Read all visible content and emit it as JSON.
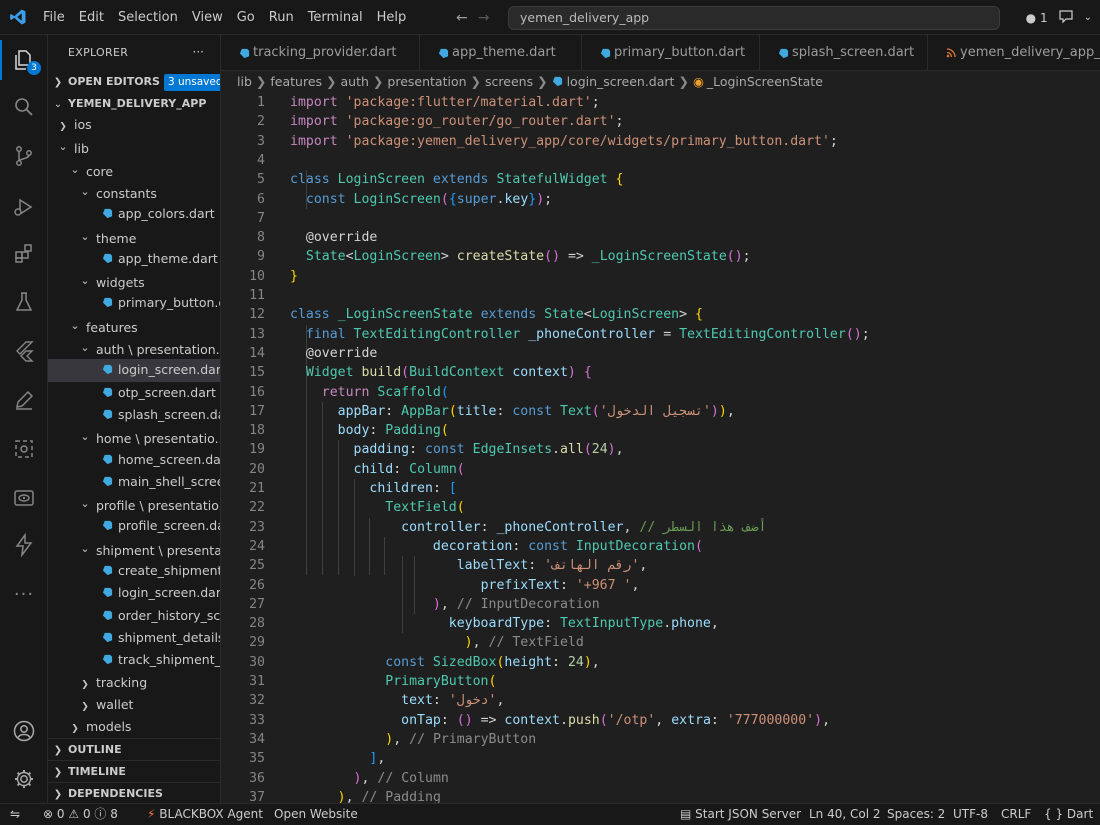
{
  "titlebar": {
    "menu": [
      "File",
      "Edit",
      "Selection",
      "View",
      "Go",
      "Run",
      "Terminal",
      "Help"
    ],
    "command_center": "yemen_delivery_app",
    "notifications_count": "1"
  },
  "activitybar": {
    "explorer_badge": "3",
    "icons": [
      "explorer-icon",
      "search-icon",
      "source-control-icon",
      "run-debug-icon",
      "extensions-icon",
      "testing-icon",
      "flutter-icon",
      "edit-icon",
      "remote-explorer-icon",
      "preview-icon",
      "bolt-icon",
      "more-icon",
      "account-icon",
      "settings-icon"
    ]
  },
  "sidebar": {
    "title": "EXPLORER",
    "more": "···",
    "open_editors": "OPEN EDITORS",
    "unsaved_badge": "3 unsaved",
    "project": "YEMEN_DELIVERY_APP",
    "tree": [
      {
        "label": "ios",
        "type": "folder",
        "expanded": false,
        "depth": 1
      },
      {
        "label": "lib",
        "type": "folder",
        "expanded": true,
        "depth": 1
      },
      {
        "label": "core",
        "type": "folder",
        "expanded": true,
        "depth": 2
      },
      {
        "label": "constants",
        "type": "folder",
        "expanded": true,
        "depth": 3
      },
      {
        "label": "app_colors.dart",
        "type": "file",
        "depth": 4
      },
      {
        "label": "theme",
        "type": "folder",
        "expanded": true,
        "depth": 3
      },
      {
        "label": "app_theme.dart",
        "type": "file",
        "depth": 4
      },
      {
        "label": "widgets",
        "type": "folder",
        "expanded": true,
        "depth": 3
      },
      {
        "label": "primary_button.dart",
        "type": "file",
        "depth": 4
      },
      {
        "label": "features",
        "type": "folder",
        "expanded": true,
        "depth": 2
      },
      {
        "label": "auth \\ presentation...",
        "type": "folder",
        "expanded": true,
        "depth": 3
      },
      {
        "label": "login_screen.dart",
        "type": "file",
        "depth": 4,
        "selected": true
      },
      {
        "label": "otp_screen.dart",
        "type": "file",
        "depth": 4
      },
      {
        "label": "splash_screen.dart",
        "type": "file",
        "depth": 4
      },
      {
        "label": "home \\ presentatio...",
        "type": "folder",
        "expanded": true,
        "depth": 3
      },
      {
        "label": "home_screen.dart",
        "type": "file",
        "depth": 4
      },
      {
        "label": "main_shell_screen....",
        "type": "file",
        "depth": 4
      },
      {
        "label": "profile \\ presentatio...",
        "type": "folder",
        "expanded": true,
        "depth": 3
      },
      {
        "label": "profile_screen.dart",
        "type": "file",
        "depth": 4
      },
      {
        "label": "shipment \\ presenta...",
        "type": "folder",
        "expanded": true,
        "depth": 3
      },
      {
        "label": "create_shipment_s...",
        "type": "file",
        "depth": 4
      },
      {
        "label": "login_screen.dart",
        "type": "file",
        "depth": 4
      },
      {
        "label": "order_history_scre...",
        "type": "file",
        "depth": 4
      },
      {
        "label": "shipment_details_...",
        "type": "file",
        "depth": 4
      },
      {
        "label": "track_shipment_sc...",
        "type": "file",
        "depth": 4
      },
      {
        "label": "tracking",
        "type": "folder",
        "expanded": false,
        "depth": 3
      },
      {
        "label": "wallet",
        "type": "folder",
        "expanded": false,
        "depth": 3
      },
      {
        "label": "models",
        "type": "folder",
        "expanded": false,
        "depth": 2
      }
    ],
    "outline": "OUTLINE",
    "timeline": "TIMELINE",
    "dependencies": "DEPENDENCIES"
  },
  "tabs": [
    {
      "label": "tracking_provider.dart",
      "icon": "dart-icon"
    },
    {
      "label": "app_theme.dart",
      "icon": "dart-icon"
    },
    {
      "label": "primary_button.dart",
      "icon": "dart-icon"
    },
    {
      "label": "splash_screen.dart",
      "icon": "dart-icon"
    },
    {
      "label": "yemen_delivery_app_and",
      "icon": "rss-icon"
    }
  ],
  "breadcrumb": [
    "lib",
    "features",
    "auth",
    "presentation",
    "screens",
    "login_screen.dart",
    "_LoginScreenState"
  ],
  "editor": {
    "lines": [
      [
        [
          "kw2",
          "import "
        ],
        [
          "str",
          "'package:flutter/material.dart'"
        ],
        [
          "pl",
          ";"
        ]
      ],
      [
        [
          "kw2",
          "import "
        ],
        [
          "str",
          "'package:go_router/go_router.dart'"
        ],
        [
          "pl",
          ";"
        ]
      ],
      [
        [
          "kw2",
          "import "
        ],
        [
          "str",
          "'package:yemen_delivery_app/core/widgets/primary_button.dart'"
        ],
        [
          "pl",
          ";"
        ]
      ],
      [],
      [
        [
          "kw",
          "class "
        ],
        [
          "cls",
          "LoginScreen "
        ],
        [
          "kw",
          "extends "
        ],
        [
          "cls",
          "StatefulWidget "
        ],
        [
          "br1",
          "{"
        ]
      ],
      [
        [
          "pl",
          "  "
        ],
        [
          "kw",
          "const "
        ],
        [
          "cls",
          "LoginScreen"
        ],
        [
          "br2",
          "("
        ],
        [
          "br3",
          "{"
        ],
        [
          "kw",
          "super"
        ],
        [
          "pl",
          "."
        ],
        [
          "var",
          "key"
        ],
        [
          "br3",
          "}"
        ],
        [
          "br2",
          ")"
        ],
        [
          "pl",
          ";"
        ]
      ],
      [],
      [
        [
          "pl",
          "  "
        ],
        [
          "ann",
          "@override"
        ]
      ],
      [
        [
          "pl",
          "  "
        ],
        [
          "cls",
          "State"
        ],
        [
          "pl",
          "<"
        ],
        [
          "cls",
          "LoginScreen"
        ],
        [
          "pl",
          "> "
        ],
        [
          "fn",
          "createState"
        ],
        [
          "br2",
          "()"
        ],
        [
          "pl",
          " => "
        ],
        [
          "cls",
          "_LoginScreenState"
        ],
        [
          "br2",
          "()"
        ],
        [
          "pl",
          ";"
        ]
      ],
      [
        [
          "br1",
          "}"
        ]
      ],
      [],
      [
        [
          "kw",
          "class "
        ],
        [
          "cls",
          "_LoginScreenState "
        ],
        [
          "kw",
          "extends "
        ],
        [
          "cls",
          "State"
        ],
        [
          "pl",
          "<"
        ],
        [
          "cls",
          "LoginScreen"
        ],
        [
          "pl",
          "> "
        ],
        [
          "br1",
          "{"
        ]
      ],
      [
        [
          "pl",
          "  "
        ],
        [
          "kw",
          "final "
        ],
        [
          "cls",
          "TextEditingController "
        ],
        [
          "var",
          "_phoneController"
        ],
        [
          "pl",
          " = "
        ],
        [
          "cls",
          "TextEditingController"
        ],
        [
          "br2",
          "()"
        ],
        [
          "pl",
          ";"
        ]
      ],
      [
        [
          "pl",
          "  "
        ],
        [
          "ann",
          "@override"
        ]
      ],
      [
        [
          "pl",
          "  "
        ],
        [
          "cls",
          "Widget "
        ],
        [
          "fn",
          "build"
        ],
        [
          "br2",
          "("
        ],
        [
          "cls",
          "BuildContext "
        ],
        [
          "var",
          "context"
        ],
        [
          "br2",
          ")"
        ],
        [
          "pl",
          " "
        ],
        [
          "br2",
          "{"
        ]
      ],
      [
        [
          "pl",
          "    "
        ],
        [
          "kw2",
          "return "
        ],
        [
          "cls",
          "Scaffold"
        ],
        [
          "br3",
          "("
        ]
      ],
      [
        [
          "pl",
          "      "
        ],
        [
          "var",
          "appBar"
        ],
        [
          "pl",
          ": "
        ],
        [
          "cls",
          "AppBar"
        ],
        [
          "br1",
          "("
        ],
        [
          "var",
          "title"
        ],
        [
          "pl",
          ": "
        ],
        [
          "kw",
          "const "
        ],
        [
          "cls",
          "Text"
        ],
        [
          "br2",
          "("
        ],
        [
          "str",
          "'تسجيل الدخول'"
        ],
        [
          "br2",
          ")"
        ],
        [
          "br1",
          ")"
        ],
        [
          "pl",
          ","
        ]
      ],
      [
        [
          "pl",
          "      "
        ],
        [
          "var",
          "body"
        ],
        [
          "pl",
          ": "
        ],
        [
          "cls",
          "Padding"
        ],
        [
          "br1",
          "("
        ]
      ],
      [
        [
          "pl",
          "        "
        ],
        [
          "var",
          "padding"
        ],
        [
          "pl",
          ": "
        ],
        [
          "kw",
          "const "
        ],
        [
          "cls",
          "EdgeInsets"
        ],
        [
          "pl",
          "."
        ],
        [
          "fn",
          "all"
        ],
        [
          "br2",
          "("
        ],
        [
          "num",
          "24"
        ],
        [
          "br2",
          ")"
        ],
        [
          "pl",
          ","
        ]
      ],
      [
        [
          "pl",
          "        "
        ],
        [
          "var",
          "child"
        ],
        [
          "pl",
          ": "
        ],
        [
          "cls",
          "Column"
        ],
        [
          "br2",
          "("
        ]
      ],
      [
        [
          "pl",
          "          "
        ],
        [
          "var",
          "children"
        ],
        [
          "pl",
          ": "
        ],
        [
          "br3",
          "["
        ]
      ],
      [
        [
          "pl",
          "            "
        ],
        [
          "cls",
          "TextField"
        ],
        [
          "br1",
          "("
        ]
      ],
      [
        [
          "pl",
          "              "
        ],
        [
          "var",
          "controller"
        ],
        [
          "pl",
          ": "
        ],
        [
          "var",
          "_phoneController"
        ],
        [
          "pl",
          ", "
        ],
        [
          "cmt",
          "// أضف هذا السطر"
        ]
      ],
      [
        [
          "pl",
          "                  "
        ],
        [
          "var",
          "decoration"
        ],
        [
          "pl",
          ": "
        ],
        [
          "kw",
          "const "
        ],
        [
          "cls",
          "InputDecoration"
        ],
        [
          "br2",
          "("
        ]
      ],
      [
        [
          "pl",
          "                     "
        ],
        [
          "var",
          "labelText"
        ],
        [
          "pl",
          ": "
        ],
        [
          "str",
          "'رقم الهاتف'"
        ],
        [
          "pl",
          ","
        ]
      ],
      [
        [
          "pl",
          "                        "
        ],
        [
          "var",
          "prefixText"
        ],
        [
          "pl",
          ": "
        ],
        [
          "str",
          "'+967 '"
        ],
        [
          "pl",
          ","
        ]
      ],
      [
        [
          "pl",
          "                  "
        ],
        [
          "br2",
          ")"
        ],
        [
          "pl",
          ", "
        ],
        [
          "cmt2",
          "// InputDecoration"
        ]
      ],
      [
        [
          "pl",
          "                    "
        ],
        [
          "var",
          "keyboardType"
        ],
        [
          "pl",
          ": "
        ],
        [
          "cls",
          "TextInputType"
        ],
        [
          "pl",
          "."
        ],
        [
          "var",
          "phone"
        ],
        [
          "pl",
          ","
        ]
      ],
      [
        [
          "pl",
          "                      "
        ],
        [
          "br1",
          ")"
        ],
        [
          "pl",
          ", "
        ],
        [
          "cmt2",
          "// TextField"
        ]
      ],
      [
        [
          "pl",
          "            "
        ],
        [
          "kw",
          "const "
        ],
        [
          "cls",
          "SizedBox"
        ],
        [
          "br1",
          "("
        ],
        [
          "var",
          "height"
        ],
        [
          "pl",
          ": "
        ],
        [
          "num",
          "24"
        ],
        [
          "br1",
          ")"
        ],
        [
          "pl",
          ","
        ]
      ],
      [
        [
          "pl",
          "            "
        ],
        [
          "cls",
          "PrimaryButton"
        ],
        [
          "br1",
          "("
        ]
      ],
      [
        [
          "pl",
          "              "
        ],
        [
          "var",
          "text"
        ],
        [
          "pl",
          ": "
        ],
        [
          "str",
          "'دخول'"
        ],
        [
          "pl",
          ","
        ]
      ],
      [
        [
          "pl",
          "              "
        ],
        [
          "var",
          "onTap"
        ],
        [
          "pl",
          ": "
        ],
        [
          "br2",
          "()"
        ],
        [
          "pl",
          " => "
        ],
        [
          "var",
          "context"
        ],
        [
          "pl",
          "."
        ],
        [
          "fn",
          "push"
        ],
        [
          "br2",
          "("
        ],
        [
          "str",
          "'/otp'"
        ],
        [
          "pl",
          ", "
        ],
        [
          "var",
          "extra"
        ],
        [
          "pl",
          ": "
        ],
        [
          "str",
          "'777000000'"
        ],
        [
          "br2",
          ")"
        ],
        [
          "pl",
          ","
        ]
      ],
      [
        [
          "pl",
          "            "
        ],
        [
          "br1",
          ")"
        ],
        [
          "pl",
          ", "
        ],
        [
          "cmt2",
          "// PrimaryButton"
        ]
      ],
      [
        [
          "pl",
          "          "
        ],
        [
          "br3",
          "]"
        ],
        [
          "pl",
          ","
        ]
      ],
      [
        [
          "pl",
          "        "
        ],
        [
          "br2",
          ")"
        ],
        [
          "pl",
          ", "
        ],
        [
          "cmt2",
          "// Column"
        ]
      ],
      [
        [
          "pl",
          "      "
        ],
        [
          "br1",
          ")"
        ],
        [
          "pl",
          ", "
        ],
        [
          "cmt2",
          "// Padding"
        ]
      ]
    ]
  },
  "statusbar": {
    "errors": "0",
    "warnings": "0",
    "info": "8",
    "blackbox": "BLACKBOX Agent",
    "open_website": "Open Website",
    "json_server": "Start JSON Server",
    "cursor": "Ln 40, Col 2",
    "spaces": "Spaces: 2",
    "encoding": "UTF-8",
    "eol": "CRLF",
    "language": "Dart",
    "language_icon": "{ }"
  },
  "colors": {
    "accent": "#0078d4",
    "dart_icon": "#40a9e0",
    "background": "#1f1f1f"
  }
}
